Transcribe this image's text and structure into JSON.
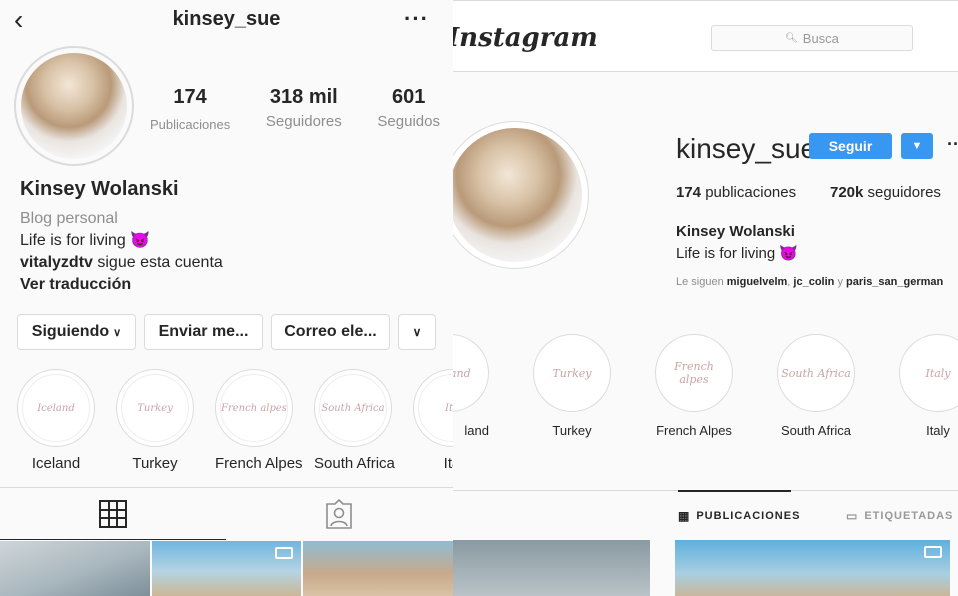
{
  "mobile": {
    "username": "kinsey_sue",
    "back_icon": "chevron-left-icon",
    "more_icon": "more-dots-icon",
    "stats": [
      {
        "num": "174",
        "label": "Publicaciones"
      },
      {
        "num": "318 mil",
        "label": "Seguidores"
      },
      {
        "num": "601",
        "label": "Seguidos"
      }
    ],
    "name": "Kinsey Wolanski",
    "category": "Blog personal",
    "bio_line": "Life is for living 😈",
    "followed_by_user": "vitalyzdtv",
    "followed_by_text": " sigue esta cuenta",
    "translate": "Ver traducción",
    "buttons": {
      "following": "Siguiendo",
      "message": "Enviar me...",
      "email": "Correo ele..."
    },
    "highlights": [
      {
        "art": "Iceland",
        "label": "Iceland"
      },
      {
        "art": "Turkey",
        "label": "Turkey"
      },
      {
        "art": "French alpes",
        "label": "French Alpes"
      },
      {
        "art": "South Africa",
        "label": "South Africa"
      },
      {
        "art": "Ita",
        "label": "Ita"
      }
    ]
  },
  "desktop": {
    "logo": "Instagram",
    "search_placeholder": "Busca",
    "username": "kinsey_sue",
    "follow_button": "Seguir",
    "posts_num": "174",
    "posts_label": " publicaciones",
    "followers_num": "720k",
    "followers_label": " seguidores",
    "name": "Kinsey Wolanski",
    "bio_line": "Life is for living 😈",
    "followed_prefix": "Le siguen ",
    "followed_users": [
      "miguelvelm",
      "jc_colin",
      "paris_san_german"
    ],
    "followed_sep": ", ",
    "followed_and": " y ",
    "highlights": [
      {
        "art": "Iceland",
        "label": "land"
      },
      {
        "art": "Turkey",
        "label": "Turkey"
      },
      {
        "art": "French alpes",
        "label": "French Alpes"
      },
      {
        "art": "South Africa",
        "label": "South Africa"
      },
      {
        "art": "Italy",
        "label": "Italy"
      }
    ],
    "tabs": {
      "posts": "PUBLICACIONES",
      "tagged": "ETIQUETADAS"
    }
  },
  "colors": {
    "accent": "#3897f0",
    "text": "#262626",
    "muted": "#8e8e8e",
    "border": "#dbdbdb"
  }
}
